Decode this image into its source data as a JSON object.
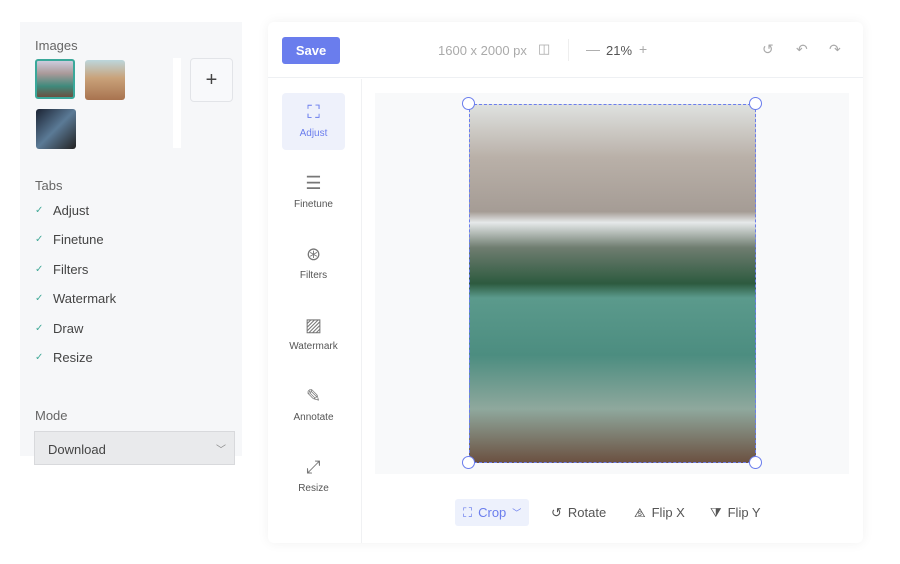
{
  "left": {
    "images_label": "Images",
    "add_label": "+",
    "tabs_label": "Tabs",
    "tabs": [
      {
        "label": "Adjust",
        "checked": true
      },
      {
        "label": "Finetune",
        "checked": true
      },
      {
        "label": "Filters",
        "checked": true
      },
      {
        "label": "Watermark",
        "checked": true
      },
      {
        "label": "Draw",
        "checked": true
      },
      {
        "label": "Resize",
        "checked": true
      }
    ],
    "mode_label": "Mode",
    "mode_value": "Download"
  },
  "header": {
    "save": "Save",
    "dimensions": "1600 x 2000 px",
    "zoom": "21%",
    "zoom_out": "—",
    "zoom_in": "+"
  },
  "tools": [
    {
      "label": "Adjust",
      "active": true
    },
    {
      "label": "Finetune"
    },
    {
      "label": "Filters"
    },
    {
      "label": "Watermark"
    },
    {
      "label": "Annotate"
    },
    {
      "label": "Resize"
    }
  ],
  "bottom": {
    "crop": "Crop",
    "rotate": "Rotate",
    "flip_x": "Flip X",
    "flip_y": "Flip Y"
  },
  "colors": {
    "accent": "#6a7ded",
    "check": "#44aa99"
  }
}
